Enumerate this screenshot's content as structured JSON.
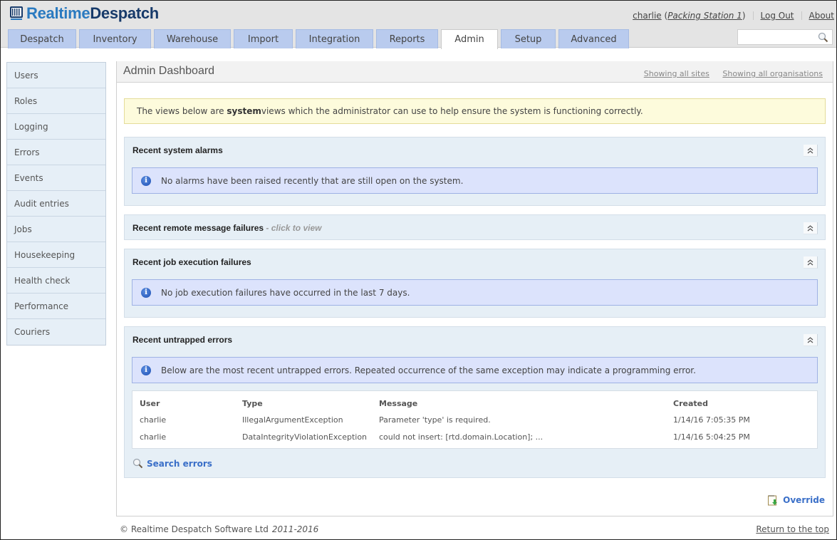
{
  "app": {
    "logo_part1": "Realtime",
    "logo_part2": "Despatch",
    "logo_icon": "barcode-monitor-icon"
  },
  "user_links": {
    "username": "charlie",
    "station": "Packing Station 1",
    "logout": "Log Out",
    "about": "About"
  },
  "tabs": [
    {
      "label": "Despatch",
      "active": false
    },
    {
      "label": "Inventory",
      "active": false
    },
    {
      "label": "Warehouse",
      "active": false
    },
    {
      "label": "Import",
      "active": false
    },
    {
      "label": "Integration",
      "active": false
    },
    {
      "label": "Reports",
      "active": false
    },
    {
      "label": "Admin",
      "active": true
    },
    {
      "label": "Setup",
      "active": false
    },
    {
      "label": "Advanced",
      "active": false
    }
  ],
  "search": {
    "value": "",
    "placeholder": "",
    "icon": "magnifier-icon"
  },
  "sidebar": {
    "items": [
      {
        "label": "Users"
      },
      {
        "label": "Roles"
      },
      {
        "label": "Logging"
      },
      {
        "label": "Errors"
      },
      {
        "label": "Events"
      },
      {
        "label": "Audit entries"
      },
      {
        "label": "Jobs"
      },
      {
        "label": "Housekeeping"
      },
      {
        "label": "Health check"
      },
      {
        "label": "Performance"
      },
      {
        "label": "Couriers"
      }
    ]
  },
  "main": {
    "title": "Admin Dashboard",
    "filter_sites": "Showing all sites",
    "filter_orgs": "Showing all organisations",
    "notice": {
      "before": "The views below are ",
      "bold": "system",
      "after": " views which the administrator can use to help ensure the system is functioning correctly."
    },
    "panels": {
      "alarms": {
        "title": "Recent system alarms",
        "info": "No alarms have been raised recently that are still open on the system."
      },
      "remote": {
        "title": "Recent remote message failures",
        "hint": " - click to view"
      },
      "jobs": {
        "title": "Recent job execution failures",
        "info": "No job execution failures have occurred in the last 7 days."
      },
      "errors": {
        "title": "Recent untrapped errors",
        "info": "Below are the most recent untrapped errors. Repeated occurrence of the same exception may indicate a programming error.",
        "columns": [
          "User",
          "Type",
          "Message",
          "Created"
        ],
        "rows": [
          {
            "user": "charlie",
            "type": "IllegalArgumentException",
            "message": "Parameter 'type' is required.",
            "created": "1/14/16 7:05:35 PM"
          },
          {
            "user": "charlie",
            "type": "DataIntegrityViolationException",
            "message": "could not insert: [rtd.domain.Location]; ...",
            "created": "1/14/16 5:04:25 PM"
          }
        ],
        "search_link": "Search errors"
      }
    },
    "override": "Override"
  },
  "footer": {
    "copyright": "© Realtime Despatch Software Ltd",
    "years": "2011-2016",
    "return_top": "Return to the top"
  },
  "colors": {
    "tab_bg": "#b9cbee",
    "panel_bg": "#e6eff6",
    "info_bg": "#dce3fc",
    "notice_bg": "#fdfbdc",
    "link_blue": "#3a6fc8",
    "logo_light": "#2a7ac0",
    "logo_dark": "#173a6a"
  }
}
